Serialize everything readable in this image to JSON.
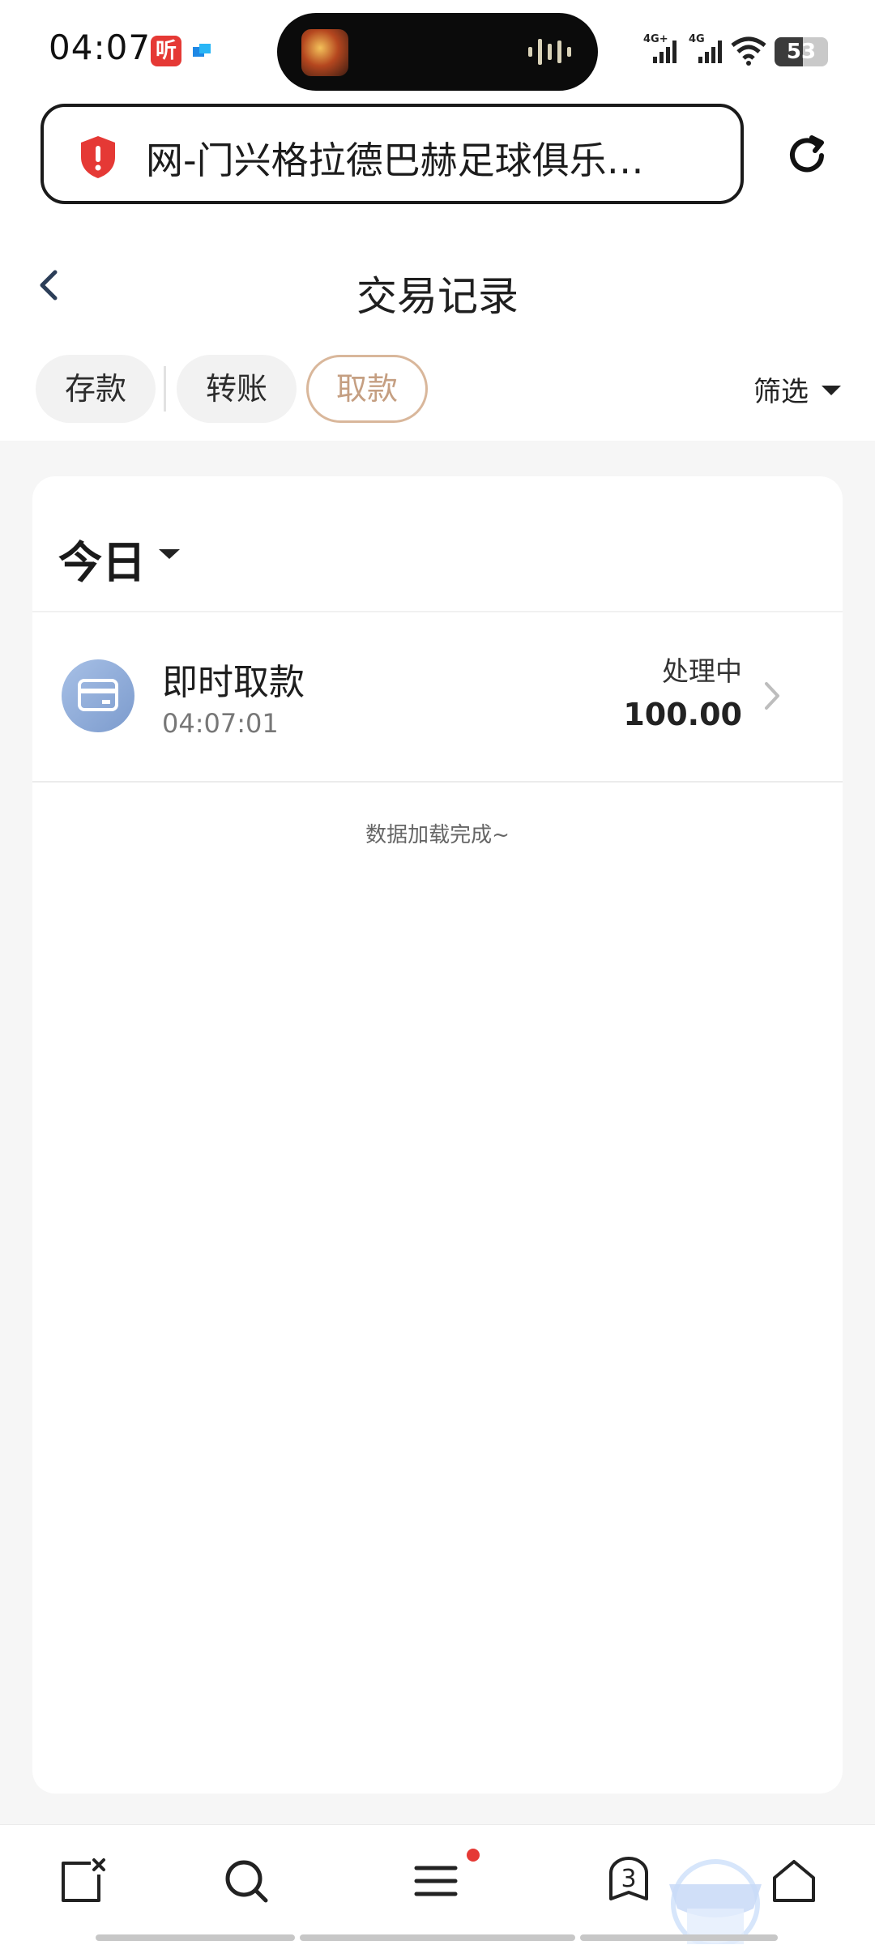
{
  "status_bar": {
    "time": "04:07",
    "app_icon_label": "听",
    "battery_level": "53",
    "signal_1_label": "4G+",
    "signal_2_label": "4G",
    "icons": [
      "signal-icon",
      "wifi-icon",
      "battery-icon"
    ]
  },
  "browser": {
    "url_title": "网-门兴格拉德巴赫足球俱乐…",
    "security_icon": "shield-alert-icon",
    "reload_icon": "reload-icon"
  },
  "header": {
    "title": "交易记录",
    "back_icon": "chevron-left-icon"
  },
  "tabs": [
    {
      "label": "存款",
      "active": false
    },
    {
      "label": "转账",
      "active": false
    },
    {
      "label": "取款",
      "active": true
    }
  ],
  "filter": {
    "label": "筛选"
  },
  "group": {
    "label": "今日"
  },
  "transactions": [
    {
      "title": "即时取款",
      "time": "04:07:01",
      "status": "处理中",
      "amount": "100.00",
      "icon": "card-icon"
    }
  ],
  "list_footer": "数据加载完成~",
  "bottom_bar": {
    "tabs_count": "3",
    "items": [
      "close-tab-icon",
      "search-icon",
      "menu-icon",
      "tabs-icon",
      "home-icon"
    ]
  },
  "colors": {
    "accent_tab_border": "#d9b79b",
    "accent_tab_text": "#c59f82",
    "alert_red": "#e53935",
    "background": "#f6f6f6"
  }
}
